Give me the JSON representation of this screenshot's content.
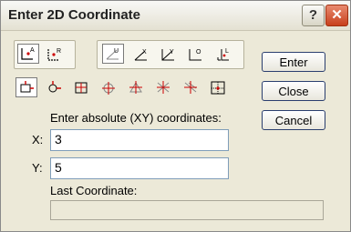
{
  "window": {
    "title": "Enter 2D Coordinate",
    "help_label": "?",
    "close_label": "✕"
  },
  "toolbar": {
    "row1": [
      {
        "name": "absolute-coordinate-icon",
        "letter": "A"
      },
      {
        "name": "relative-coordinate-icon",
        "letter": "R"
      },
      {
        "name": "user-coordinate-icon",
        "letter": "U"
      },
      {
        "name": "x-offset-icon",
        "letter": "X"
      },
      {
        "name": "y-offset-icon",
        "letter": "Y"
      },
      {
        "name": "polar-coordinate-icon",
        "letter": "O"
      },
      {
        "name": "length-angle-icon",
        "letter": "L"
      }
    ],
    "row2": [
      {
        "name": "snap-endpoint-icon"
      },
      {
        "name": "snap-midpoint-icon"
      },
      {
        "name": "snap-center-icon"
      },
      {
        "name": "snap-intersection-icon"
      },
      {
        "name": "snap-perpendicular-icon"
      },
      {
        "name": "snap-tangent-icon"
      },
      {
        "name": "snap-nearest-icon"
      },
      {
        "name": "snap-grid-icon"
      }
    ]
  },
  "buttons": {
    "enter": "Enter",
    "close": "Close",
    "cancel": "Cancel"
  },
  "form": {
    "instruction": "Enter absolute (XY) coordinates:",
    "x_label": "X:",
    "x_value": "3",
    "y_label": "Y:",
    "y_value": "5",
    "last_label": "Last Coordinate:",
    "last_value": ""
  },
  "colors": {
    "dialog_bg": "#ece9d8",
    "close_button": "#c8401d"
  }
}
